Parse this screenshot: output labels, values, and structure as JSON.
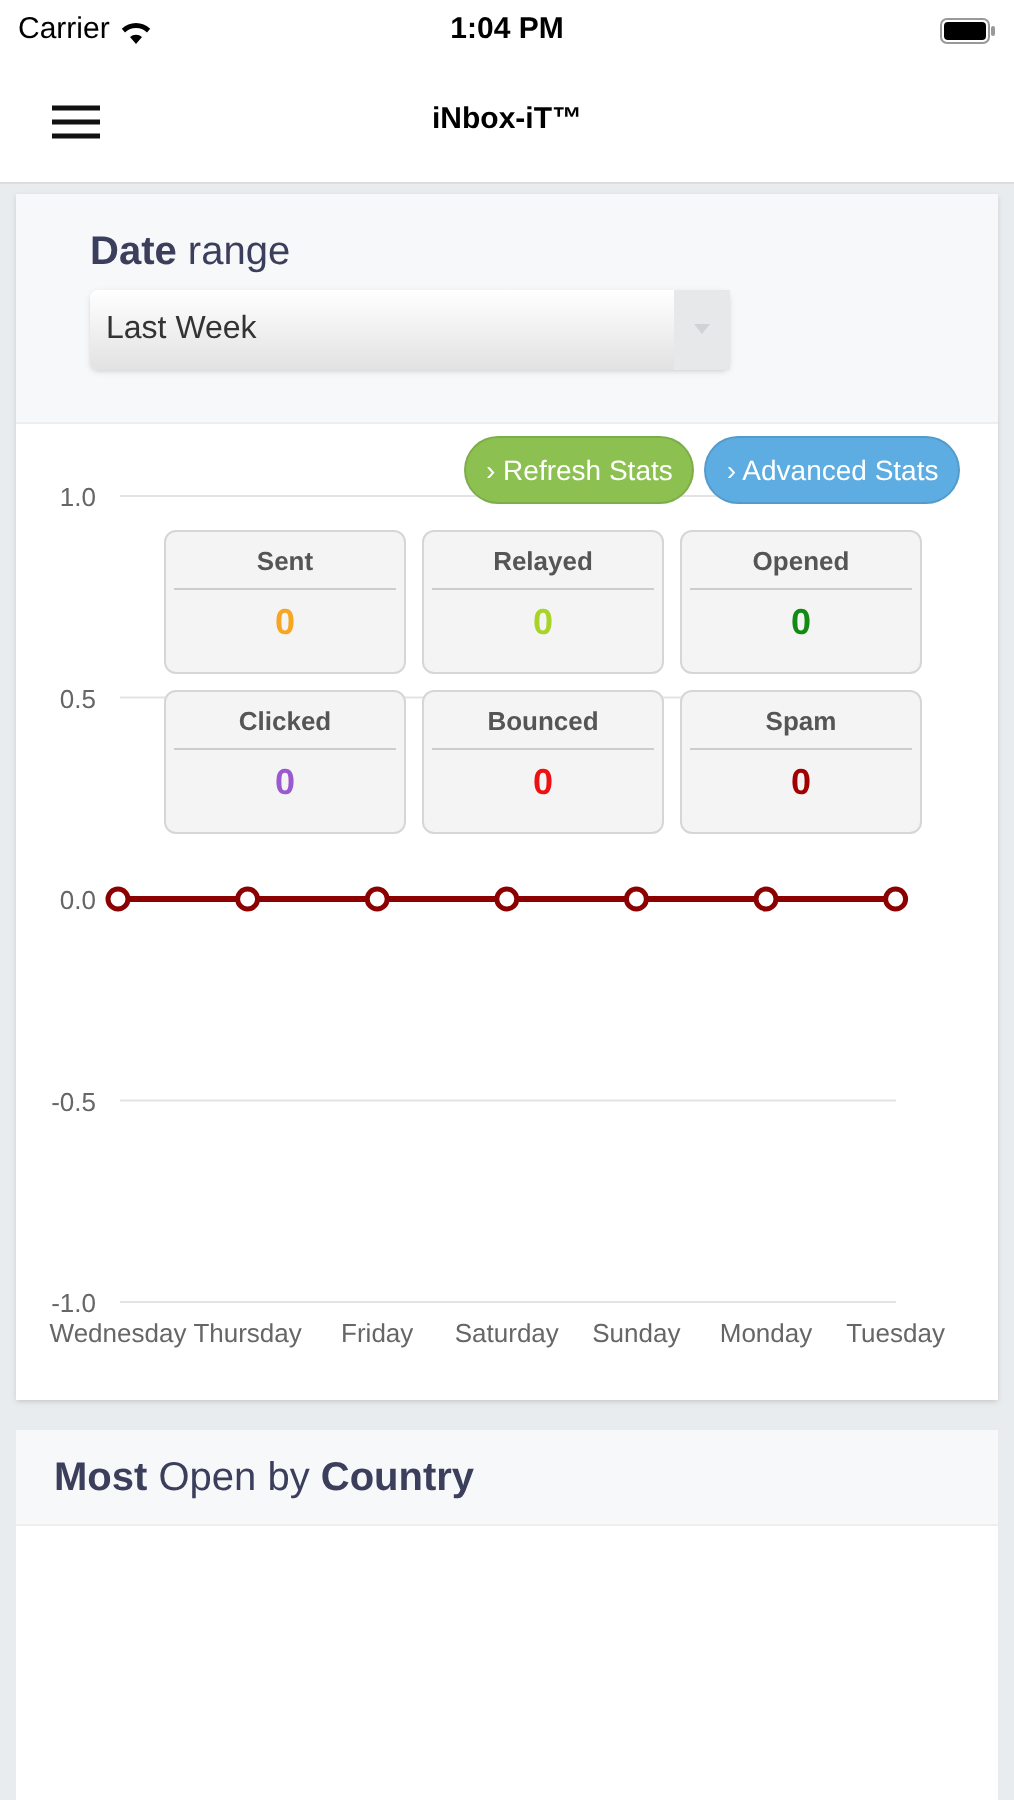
{
  "status_bar": {
    "carrier": "Carrier",
    "time": "1:04 PM"
  },
  "nav": {
    "title": "iNbox-iT™"
  },
  "date_range": {
    "label": "**Date** range",
    "value": "Last Week"
  },
  "buttons": [
    {
      "label": "› Refresh Stats",
      "color": "#8cc152"
    },
    {
      "label": "› Advanced Stats",
      "color": "#5dade2"
    }
  ],
  "stats": [
    {
      "label": "Sent",
      "value": "0",
      "color": "#f5a623"
    },
    {
      "label": "Relayed",
      "value": "0",
      "color": "#a8d42a"
    },
    {
      "label": "Opened",
      "value": "0",
      "color": "#138a13"
    },
    {
      "label": "Clicked",
      "value": "0",
      "color": "#9b59d0"
    },
    {
      "label": "Bounced",
      "value": "0",
      "color": "#ee1111"
    },
    {
      "label": "Spam",
      "value": "0",
      "color": "#a00000"
    }
  ],
  "chart_data": {
    "type": "line",
    "categories": [
      "Wednesday",
      "Thursday",
      "Friday",
      "Saturday",
      "Sunday",
      "Monday",
      "Tuesday"
    ],
    "series": [
      {
        "color": "#8b0000",
        "marker": true,
        "values": [
          0,
          0,
          0,
          0,
          0,
          0,
          0
        ]
      }
    ],
    "ylim": [
      -1,
      1
    ],
    "yticks": [
      {
        "value": 1,
        "label": "1.0"
      },
      {
        "value": 0.5,
        "label": "0.5"
      },
      {
        "value": 0,
        "label": "0.0"
      },
      {
        "value": -0.5,
        "label": "-0.5"
      },
      {
        "value": -1,
        "label": "-1.0"
      }
    ]
  },
  "country_panel": {
    "title": "**Most** Open by **Country**"
  }
}
